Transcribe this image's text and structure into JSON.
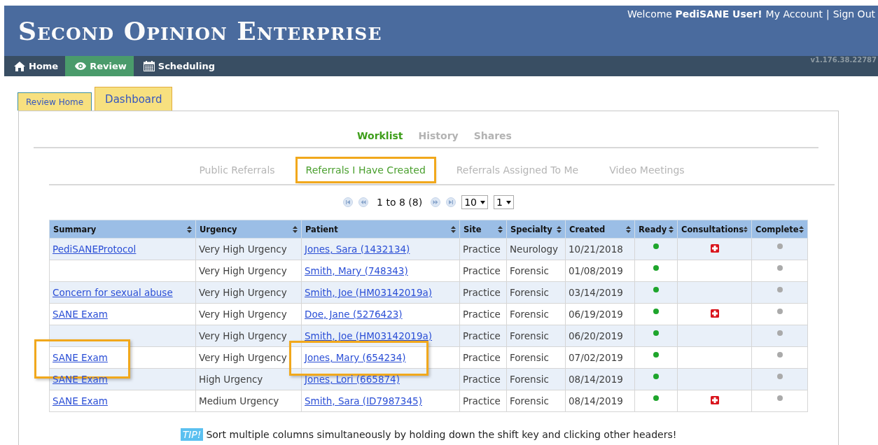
{
  "header": {
    "title": "Second Opinion Enterprise",
    "welcome": "Welcome **PediSANE User!**",
    "links": [
      "My Account",
      "Sign Out"
    ],
    "separator": "|",
    "version": "v1.176.38.22787"
  },
  "nav": [
    {
      "label": "Home",
      "kind": "home",
      "selected": false
    },
    {
      "label": "Review",
      "kind": "review",
      "selected": true
    },
    {
      "label": "Scheduling",
      "kind": "scheduling",
      "selected": false
    }
  ],
  "tabs": [
    {
      "label": "Review Home",
      "selected": false
    },
    {
      "label": "Dashboard",
      "selected": true
    }
  ],
  "section_tabs": [
    {
      "label": "Worklist",
      "selected": true
    },
    {
      "label": "History",
      "selected": false
    },
    {
      "label": "Shares",
      "selected": false
    }
  ],
  "sub_tabs": [
    {
      "label": "Public Referrals",
      "selected": false,
      "highlighted": false
    },
    {
      "label": "Referrals I Have Created",
      "selected": true,
      "highlighted": true
    },
    {
      "label": "Referrals Assigned To Me",
      "selected": false,
      "highlighted": false
    },
    {
      "label": "Video Meetings",
      "selected": false,
      "highlighted": false
    }
  ],
  "pager": {
    "range": "1 to 8 (8)",
    "page_size": "10",
    "page": "1"
  },
  "table": {
    "columns": [
      "Summary",
      "Urgency",
      "Patient",
      "Site",
      "Specialty",
      "Created",
      "Ready",
      "Consultations",
      "Complete"
    ],
    "rows": [
      {
        "summary": "PediSANEProtocol",
        "urgency": "Very High Urgency",
        "patient": "Jones, Sara (1432134)",
        "site": "Practice",
        "specialty": "Neurology",
        "created": "10/21/2018",
        "ready": true,
        "consultation": true,
        "complete": false,
        "highlighted": false
      },
      {
        "urgency": "Very High Urgency",
        "patient": "Smith, Mary (748343)",
        "site": "Practice",
        "specialty": "Forensic",
        "created": "01/08/2019",
        "ready": true,
        "consultation": false,
        "complete": false,
        "highlighted": false
      },
      {
        "summary": "Concern for sexual abuse",
        "urgency": "Very High Urgency",
        "patient": "Smith, Joe (HM03142019a)",
        "site": "Practice",
        "specialty": "Forensic",
        "created": "03/14/2019",
        "ready": true,
        "consultation": false,
        "complete": false,
        "highlighted": false
      },
      {
        "summary": "SANE Exam",
        "urgency": "Very High Urgency",
        "patient": "Doe, Jane (5276423)",
        "site": "Practice",
        "specialty": "Forensic",
        "created": "06/19/2019",
        "ready": true,
        "consultation": true,
        "complete": false,
        "highlighted": false
      },
      {
        "urgency": "Very High Urgency",
        "patient": "Smith, Joe (HM03142019a)",
        "site": "Practice",
        "specialty": "Forensic",
        "created": "06/20/2019",
        "ready": true,
        "consultation": false,
        "complete": false,
        "highlighted": false
      },
      {
        "summary": "SANE Exam",
        "urgency": "Very High Urgency",
        "patient": "Jones, Mary (654234)",
        "site": "Practice",
        "specialty": "Forensic",
        "created": "07/02/2019",
        "ready": true,
        "consultation": false,
        "complete": false,
        "highlighted": true
      },
      {
        "summary": "SANE Exam",
        "urgency": "High Urgency",
        "patient": "Jones, Lori (665874)",
        "site": "Practice",
        "specialty": "Forensic",
        "created": "08/14/2019",
        "ready": true,
        "consultation": false,
        "complete": false,
        "highlighted": false
      },
      {
        "summary": "SANE Exam",
        "urgency": "Medium Urgency",
        "patient": "Smith, Sara (ID7987345)",
        "site": "Practice",
        "specialty": "Forensic",
        "created": "08/14/2019",
        "ready": true,
        "consultation": true,
        "complete": false,
        "highlighted": false
      }
    ]
  },
  "tip": {
    "badge": "TIP!",
    "text": "Sort multiple columns simultaneously by holding down the shift key and clicking other headers!"
  }
}
